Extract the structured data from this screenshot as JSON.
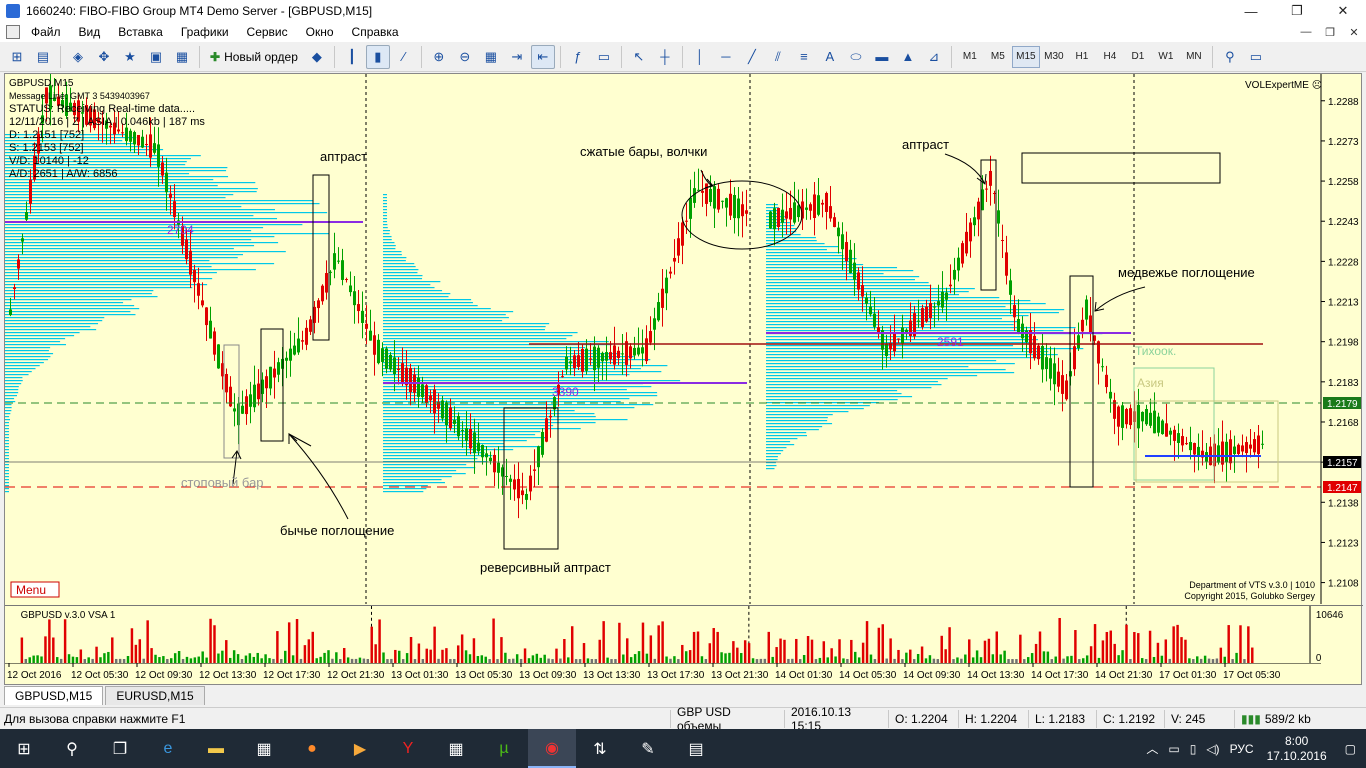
{
  "window": {
    "title": "1660240: FIBO-FIBO Group MT4 Demo Server - [GBPUSD,M15]",
    "min": "—",
    "restore": "❐",
    "close": "✕"
  },
  "menu": [
    "Файл",
    "Вид",
    "Вставка",
    "Графики",
    "Сервис",
    "Окно",
    "Справка"
  ],
  "toolbar": {
    "new_order": "Новый ордер",
    "timeframes": [
      "M1",
      "M5",
      "M15",
      "M30",
      "H1",
      "H4",
      "D1",
      "W1",
      "MN"
    ],
    "active_timeframe": "M15"
  },
  "chart": {
    "symbol_label": "GBPUSD,M15",
    "info_lines": [
      "Message Line: GMT 3  5439403967",
      "STATUS:  Receiving Real-time data.....",
      "12/11/2016 | Z | ASIA | 0.046kb | 187 ms",
      "D: 1.2151 [752]",
      "S: 1.2153 [752]",
      "V/D: 10140 | -12",
      "A/D: 2651 | A/W: 6856"
    ],
    "expert": "VOLExpertME ☹",
    "menu_button": "Menu",
    "copyright_1": "Department of VTS  v.3.0 | 1010",
    "copyright_2": "Copyright 2015, Golubko Sergey",
    "price_labels": [
      "1.2288",
      "1.2273",
      "1.2258",
      "1.2243",
      "1.2228",
      "1.2213",
      "1.2198",
      "1.2183",
      "1.2168",
      "1.2153",
      "1.2138",
      "1.2123",
      "1.2108"
    ],
    "price_level_values": [
      1.2288,
      1.2273,
      1.2258,
      1.2243,
      1.2228,
      1.2213,
      1.2198,
      1.2183,
      1.2168,
      1.2153,
      1.2138,
      1.2123,
      1.2108
    ],
    "green_level": "1.2179",
    "current_price": "1.2157",
    "red_level": "1.2147",
    "poc_labels": [
      "2704",
      "3390",
      "2591"
    ],
    "annotations": [
      "аптраст",
      "сжатые бары, волчки",
      "аптраст",
      "медвежье поглощение",
      "стоповый бар",
      "бычье поглощение",
      "реверсивный аптраст",
      "Тихоок.",
      "Азия"
    ],
    "sub_title": "GBPUSD v.3.0 VSA 1",
    "sub_max": "10646",
    "sub_zero": "0",
    "time_labels": [
      "12 Oct 2016",
      "12 Oct 05:30",
      "12 Oct 09:30",
      "12 Oct 13:30",
      "12 Oct 17:30",
      "12 Oct 21:30",
      "13 Oct 01:30",
      "13 Oct 05:30",
      "13 Oct 09:30",
      "13 Oct 13:30",
      "13 Oct 17:30",
      "13 Oct 21:30",
      "14 Oct 01:30",
      "14 Oct 05:30",
      "14 Oct 09:30",
      "14 Oct 13:30",
      "14 Oct 17:30",
      "14 Oct 21:30",
      "17 Oct 01:30",
      "17 Oct 05:30"
    ]
  },
  "tabs": [
    "GBPUSD,M15",
    "EURUSD,M15"
  ],
  "status": {
    "help": "Для вызова справки нажмите F1",
    "profile": "GBP USD объемы",
    "datetime": "2016.10.13 15:15",
    "open": "O: 1.2204",
    "high": "H: 1.2204",
    "low": "L: 1.2183",
    "close": "C: 1.2192",
    "volume": "V: 245",
    "traffic": "589/2 kb"
  },
  "taskbar": {
    "lang": "РУС",
    "time": "8:00",
    "date": "17.10.2016"
  },
  "colors": {
    "chart_bg": "#ffffd0",
    "bull": "#00a000",
    "bear": "#e00000",
    "profile": "#00c8e8",
    "poc": "#8a2be2"
  }
}
